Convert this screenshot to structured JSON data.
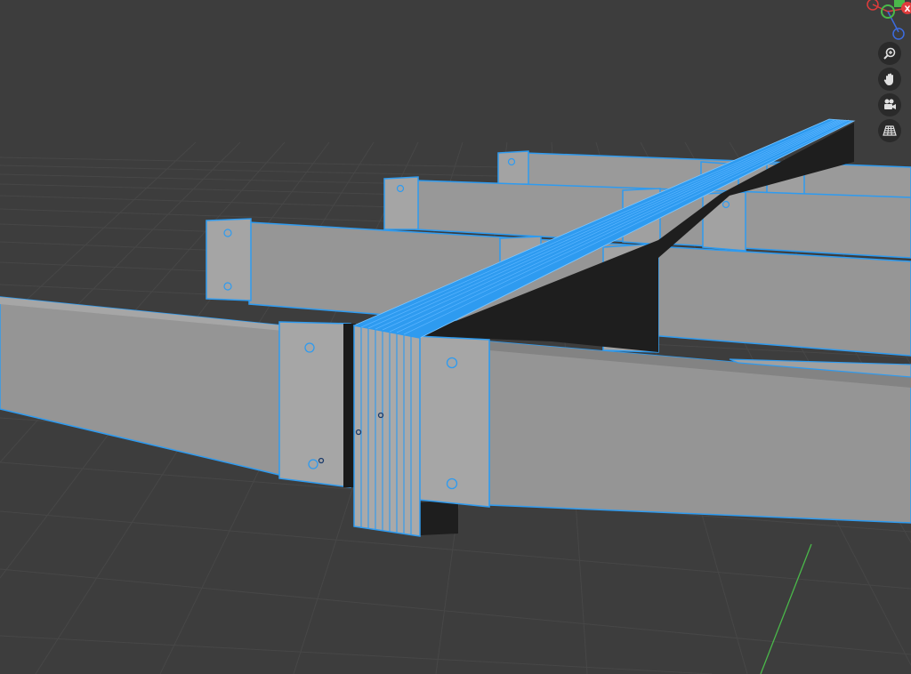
{
  "viewport": {
    "background_color": "#3d3d3d",
    "grid_color": "#4a4a4a",
    "selection_color": "#2e9bf0",
    "beam_color": "#939393",
    "beam_light_color": "#a3a3a3",
    "shadow_color": "#1e1e1e"
  },
  "gizmo": {
    "x_axis_label": "X",
    "x_color": "#e03c3c",
    "y_color": "#4ab84a",
    "z_color": "#3c6ce0"
  },
  "navigation": {
    "buttons": [
      {
        "name": "zoom",
        "icon": "zoom-icon"
      },
      {
        "name": "pan",
        "icon": "hand-icon"
      },
      {
        "name": "camera",
        "icon": "camera-icon"
      },
      {
        "name": "perspective",
        "icon": "grid-icon"
      }
    ]
  }
}
